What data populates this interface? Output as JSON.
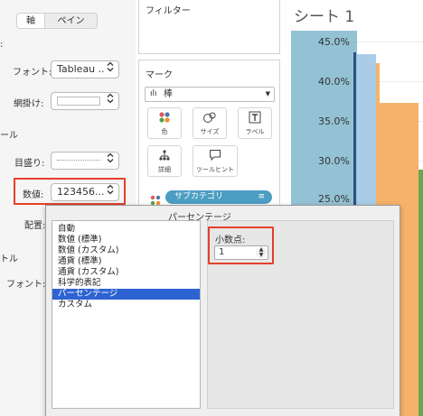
{
  "format_pane": {
    "tabs": {
      "axis": "軸",
      "pane": "ペイン"
    },
    "colon_mark": ":",
    "font_label": "フォント:",
    "font_value": "Tableau ..",
    "shading_label": "網掛け:",
    "tool_section": "ール",
    "gridlines_label": "目盛り:",
    "numbers_label": "数値:",
    "numbers_value": "123456...",
    "alignment_label": "配置:",
    "title_section": "トル",
    "title_font_label": "フォント:"
  },
  "shelves": {
    "filters_title": "フィルター",
    "marks_title": "マーク",
    "mark_type": "棒",
    "buttons": {
      "color": "色",
      "size": "サイズ",
      "label": "ラベル",
      "detail": "詳細",
      "tooltip": "ツールヒント"
    },
    "pill_label": "サブカテゴリ"
  },
  "sheet": {
    "title": "シート 1",
    "ticks": [
      "45.0%",
      "40.0%",
      "35.0%",
      "30.0%",
      "25.0%"
    ]
  },
  "popup": {
    "title": "パーセンテージ",
    "formats": [
      "自動",
      "数値 (標準)",
      "数値 (カスタム)",
      "通貨 (標準)",
      "通貨 (カスタム)",
      "科学的表記",
      "パーセンテージ",
      "カスタム"
    ],
    "selected_index": 6,
    "decimals_label": "小数点:",
    "decimals_value": "1"
  },
  "colors": {
    "accent_highlight": "#e2412a",
    "selection_blue": "#2e63d3",
    "pill_blue": "#4b9ec2",
    "bar_blue": "#94c2d5",
    "bar_orange": "#f6b26b",
    "bar_green": "#6aa84f"
  },
  "icons": {
    "mark_type": "bar-chart-icon",
    "color": "color-dots-icon",
    "size": "size-circles-icon",
    "label": "label-T-icon",
    "detail": "detail-tree-icon",
    "tooltip": "tooltip-bubble-icon",
    "pill": "color-dots-icon",
    "pill_sort": "sort-icon"
  }
}
